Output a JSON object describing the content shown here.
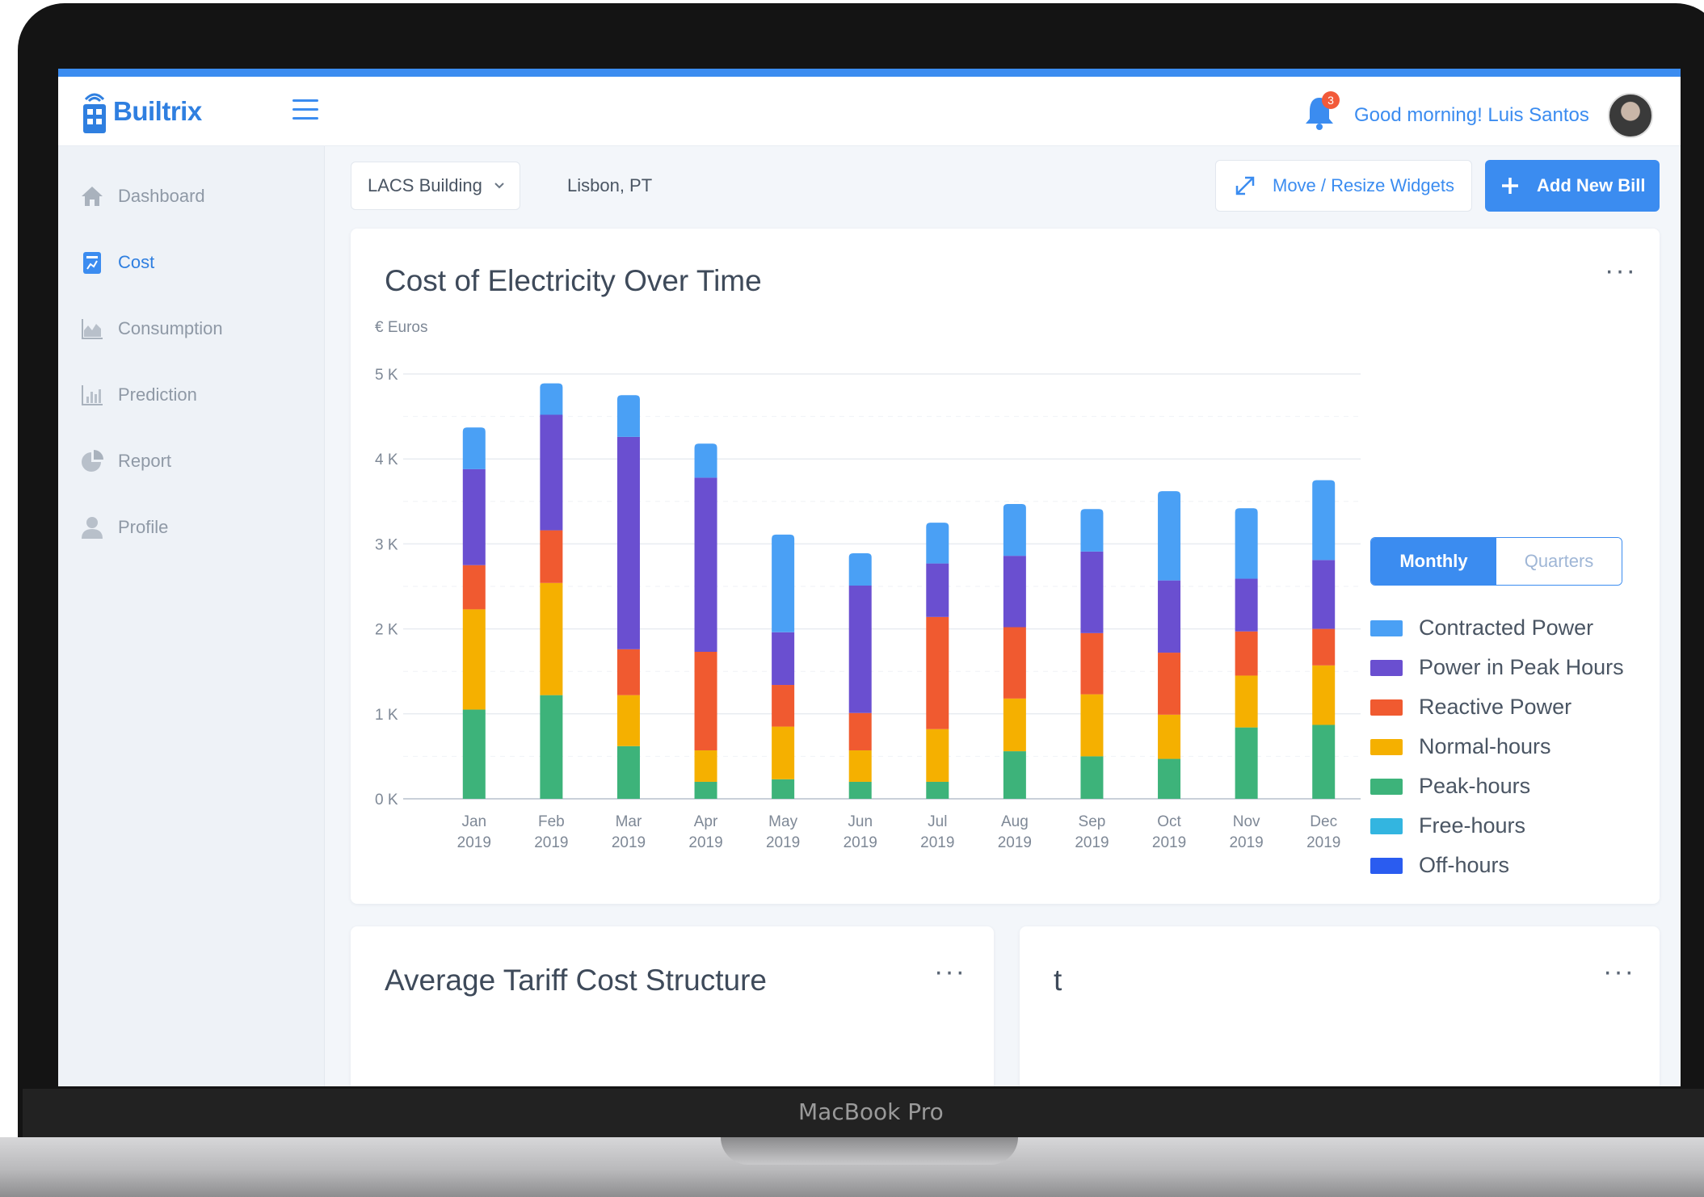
{
  "device": {
    "label": "MacBook Pro"
  },
  "app": {
    "name": "Builtrix",
    "greeting": "Good morning! Luis Santos",
    "notification_count": "3"
  },
  "sidebar": {
    "items": [
      {
        "label": "Dashboard",
        "icon": "home-icon",
        "active": false
      },
      {
        "label": "Cost",
        "icon": "cost-icon",
        "active": true
      },
      {
        "label": "Consumption",
        "icon": "area-chart-icon",
        "active": false
      },
      {
        "label": "Prediction",
        "icon": "bar-chart-icon",
        "active": false
      },
      {
        "label": "Report",
        "icon": "pie-chart-icon",
        "active": false
      },
      {
        "label": "Profile",
        "icon": "user-icon",
        "active": false
      }
    ]
  },
  "toolbar": {
    "building": "LACS Building",
    "location": "Lisbon, PT",
    "move_label": "Move / Resize Widgets",
    "add_label": "Add New Bill"
  },
  "main_card": {
    "title": "Cost of Electricity Over Time",
    "toggle": {
      "selected": "Monthly",
      "other": "Quarters"
    }
  },
  "cards": {
    "bottom_left_title": "Average Tariff Cost Structure",
    "bottom_right_title": "t"
  },
  "colors": {
    "accent": "#3b8cf0",
    "Contracted Power": "#4aa0f5",
    "Power in Peak Hours": "#6a4fd0",
    "Reactive Power": "#f05a30",
    "Normal-hours": "#f5b000",
    "Peak-hours": "#3db37a",
    "Free-hours": "#33b5e0",
    "Off-hours": "#2a5cf0"
  },
  "chart_data": {
    "type": "bar",
    "stacked": true,
    "ylabel": "€ Euros",
    "ylim": [
      0,
      5000
    ],
    "yticks": [
      "0 K",
      "1 K",
      "2 K",
      "3 K",
      "4 K",
      "5 K"
    ],
    "ytick_values": [
      0,
      1000,
      2000,
      3000,
      4000,
      5000
    ],
    "categories": [
      "Jan",
      "Feb",
      "Mar",
      "Apr",
      "May",
      "Jun",
      "Jul",
      "Aug",
      "Sep",
      "Oct",
      "Nov",
      "Dec"
    ],
    "category_years": [
      "2019",
      "2019",
      "2019",
      "2019",
      "2019",
      "2019",
      "2019",
      "2019",
      "2019",
      "2019",
      "2019",
      "2019"
    ],
    "legend_position": "right",
    "grid": true,
    "series": [
      {
        "name": "Peak-hours",
        "values": [
          1050,
          1220,
          620,
          200,
          230,
          200,
          200,
          560,
          500,
          470,
          840,
          870
        ]
      },
      {
        "name": "Normal-hours",
        "values": [
          1180,
          1320,
          600,
          370,
          620,
          370,
          620,
          620,
          730,
          520,
          610,
          700
        ]
      },
      {
        "name": "Reactive Power",
        "values": [
          520,
          620,
          540,
          1160,
          490,
          440,
          1320,
          840,
          720,
          730,
          520,
          430
        ]
      },
      {
        "name": "Power in Peak Hours",
        "values": [
          1130,
          1360,
          2500,
          2050,
          620,
          1500,
          630,
          840,
          960,
          850,
          620,
          810
        ]
      },
      {
        "name": "Contracted Power",
        "values": [
          490,
          370,
          490,
          400,
          1150,
          380,
          480,
          610,
          500,
          1050,
          830,
          940
        ]
      },
      {
        "name": "Free-hours",
        "values": [
          0,
          0,
          0,
          0,
          0,
          0,
          0,
          0,
          0,
          0,
          0,
          0
        ]
      },
      {
        "name": "Off-hours",
        "values": [
          0,
          0,
          0,
          0,
          0,
          0,
          0,
          0,
          0,
          0,
          0,
          0
        ]
      }
    ],
    "legend_order": [
      "Contracted Power",
      "Power in Peak Hours",
      "Reactive Power",
      "Normal-hours",
      "Peak-hours",
      "Free-hours",
      "Off-hours"
    ]
  }
}
